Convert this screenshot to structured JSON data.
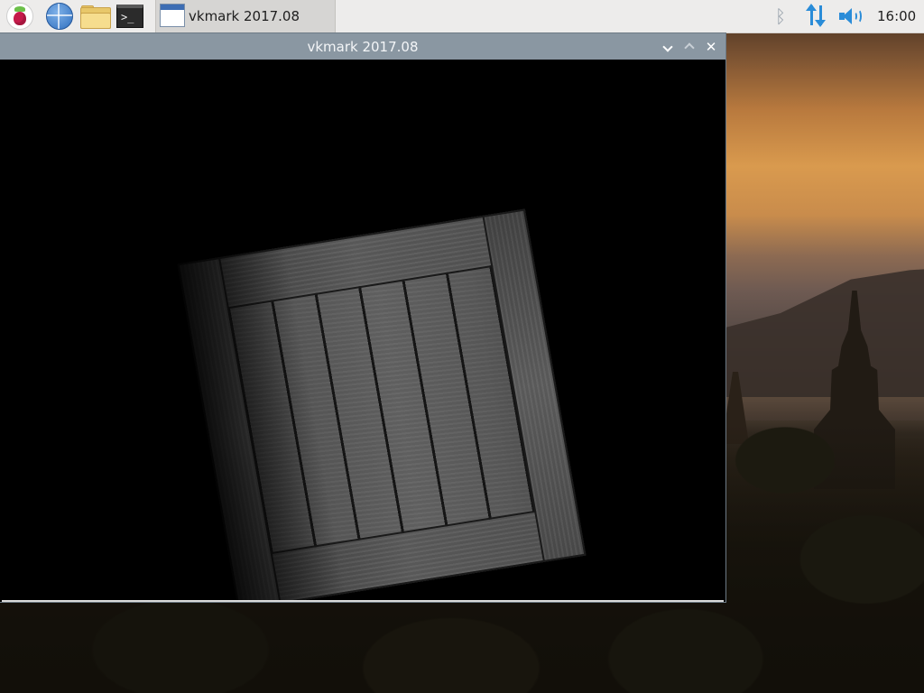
{
  "taskbar": {
    "launchers": [
      {
        "name": "raspberry-pi-menu",
        "icon": "raspberry-icon"
      },
      {
        "name": "web-browser",
        "icon": "globe-icon"
      },
      {
        "name": "file-manager",
        "icon": "folder-icon"
      },
      {
        "name": "terminal",
        "icon": "terminal-icon",
        "glyph": ">_"
      }
    ],
    "task_button": {
      "label": "vkmark 2017.08",
      "icon": "app-window-icon"
    },
    "tray": {
      "bluetooth_icon": "bluetooth-icon",
      "network_icon": "network-updown-icon",
      "volume_icon": "volume-icon",
      "clock": "16:00"
    },
    "colors": {
      "panel_bg": "#edeceb",
      "tray_accent": "#2a8cd8"
    }
  },
  "window": {
    "title": "vkmark 2017.08",
    "controls": {
      "minimize_icon": "chevron-down-icon",
      "maximize_icon": "chevron-up-icon",
      "close_icon": "close-icon",
      "close_glyph": "✕"
    },
    "colors": {
      "titlebar_bg": "#8a97a2",
      "title_text": "#f3f5f7",
      "viewport_bg": "#000000"
    },
    "content": {
      "scene": "textured-wooden-crate"
    }
  }
}
